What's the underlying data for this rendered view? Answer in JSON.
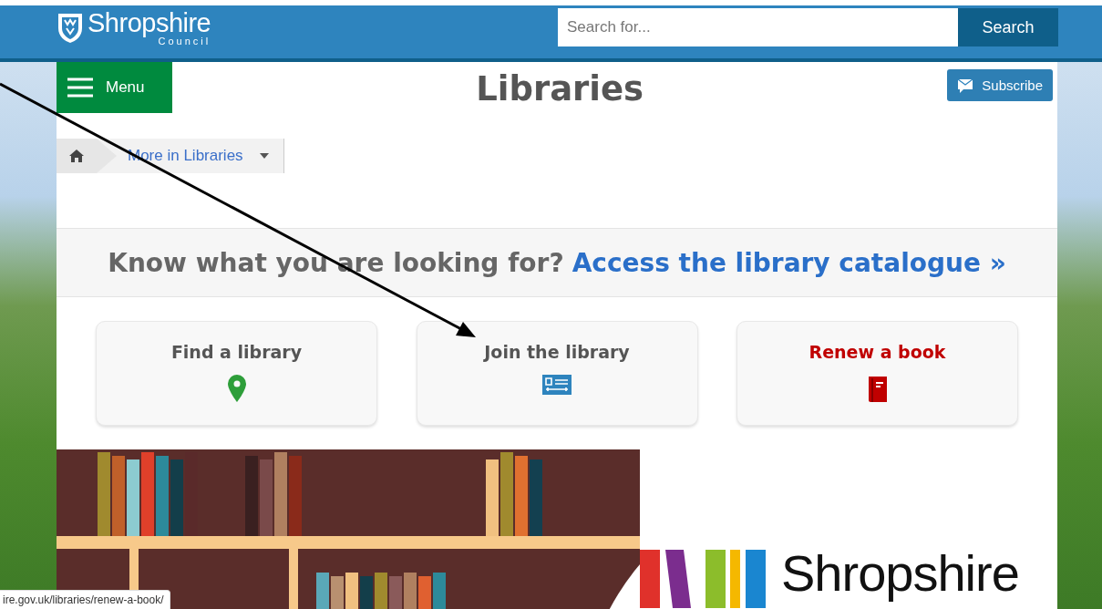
{
  "header": {
    "logo_name": "Shropshire",
    "logo_sub": "Council",
    "search": {
      "placeholder": "Search for..."
    },
    "search_button": "Search"
  },
  "menu_button": "Menu",
  "page_title": "Libraries",
  "subscribe_button": "Subscribe",
  "breadcrumb": {
    "dropdown": "More in Libraries"
  },
  "catalogue_banner": {
    "prompt": "Know what you are looking for?",
    "link": "Access the library catalogue »"
  },
  "cards": [
    {
      "label": "Find a library",
      "kind": "pin",
      "hovered": false
    },
    {
      "label": "Join the library",
      "kind": "card",
      "hovered": false
    },
    {
      "label": "Renew a book",
      "kind": "book",
      "hovered": true
    }
  ],
  "banner": {
    "logo_text": "Shropshire"
  },
  "status_bar": {
    "url": "ire.gov.uk/libraries/renew-a-book/"
  }
}
